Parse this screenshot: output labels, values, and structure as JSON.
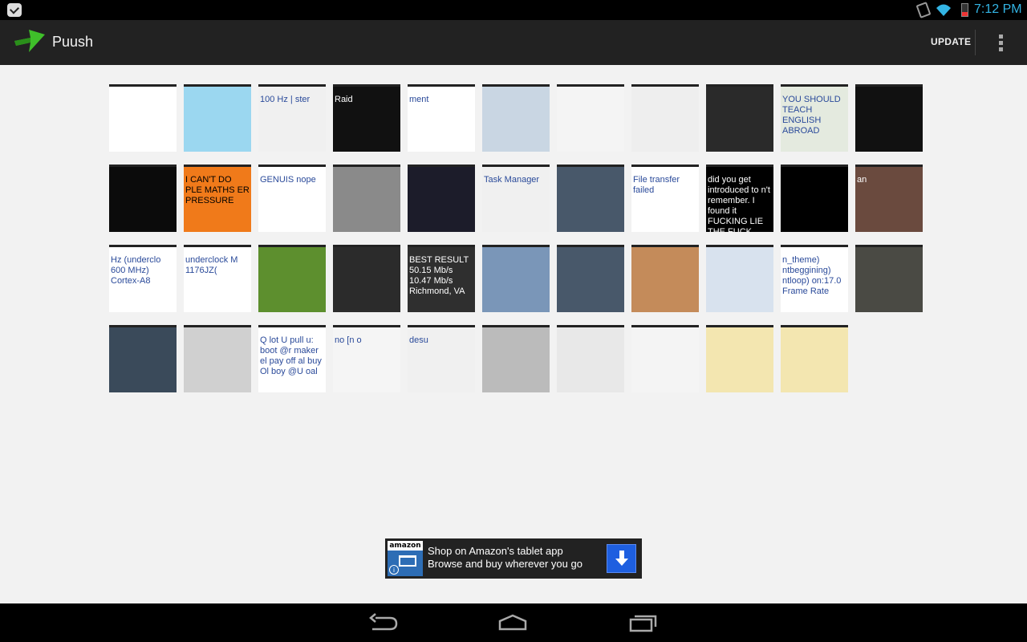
{
  "status_bar": {
    "time": "7:12 PM",
    "icons": [
      "notification-icon",
      "screen-rotation-icon",
      "wifi-icon",
      "battery-icon"
    ]
  },
  "action_bar": {
    "title": "Puush",
    "update_label": "UPDATE",
    "logo_icon": "puush-arrow-icon",
    "overflow_icon": "overflow-menu-icon",
    "accent_color": "#33b5e5",
    "logo_color": "#3fbf2a"
  },
  "thumbnails": [
    {
      "caption": "",
      "bg": "#ffffff"
    },
    {
      "caption": "",
      "bg": "#9bd7f0"
    },
    {
      "caption": "100 Hz | ster",
      "bg": "#f0f0f0"
    },
    {
      "caption": "Raid",
      "bg": "#111111"
    },
    {
      "caption": "ment",
      "bg": "#ffffff"
    },
    {
      "caption": "",
      "bg": "#c9d6e3"
    },
    {
      "caption": "",
      "bg": "#f4f4f4"
    },
    {
      "caption": "",
      "bg": "#eeeeee"
    },
    {
      "caption": "",
      "bg": "#2a2a2a"
    },
    {
      "caption": "YOU SHOULD TEACH ENGLISH ABROAD",
      "bg": "#e4eadf"
    },
    {
      "caption": "",
      "bg": "#111111"
    },
    {
      "caption": "",
      "bg": "#0b0b0b"
    },
    {
      "caption": "I CAN'T DO PLE MATHS ER PRESSURE",
      "bg": "#f07a1a"
    },
    {
      "caption": "GENUIS nope",
      "bg": "#ffffff"
    },
    {
      "caption": "",
      "bg": "#8a8a8a"
    },
    {
      "caption": "",
      "bg": "#1c1c2a"
    },
    {
      "caption": "Task Manager",
      "bg": "#f0f0f0"
    },
    {
      "caption": "",
      "bg": "#48586a"
    },
    {
      "caption": "File transfer failed",
      "bg": "#ffffff"
    },
    {
      "caption": "did you get introduced to n't remember. I found it FUCKING LIE THE FUCK OUT",
      "bg": "#000000"
    },
    {
      "caption": "",
      "bg": "#000000"
    },
    {
      "caption": "an",
      "bg": "#6a4a3e"
    },
    {
      "caption": "Hz (underclo 600 MHz) Cortex-A8",
      "bg": "#ffffff"
    },
    {
      "caption": "underclock M 1176JZ(",
      "bg": "#ffffff"
    },
    {
      "caption": "",
      "bg": "#5d8f2e"
    },
    {
      "caption": "",
      "bg": "#2b2b2b"
    },
    {
      "caption": "BEST RESULT 50.15 Mb/s 10.47 Mb/s Richmond, VA",
      "bg": "#2f2f2f"
    },
    {
      "caption": "",
      "bg": "#7a96b8"
    },
    {
      "caption": "",
      "bg": "#48586a"
    },
    {
      "caption": "",
      "bg": "#c48b5a"
    },
    {
      "caption": "",
      "bg": "#d8e2ee"
    },
    {
      "caption": "n_theme) ntbeggining) ntloop) on:17.0 Frame Rate",
      "bg": "#ffffff"
    },
    {
      "caption": "",
      "bg": "#4a4a44"
    },
    {
      "caption": "",
      "bg": "#3a4a5a"
    },
    {
      "caption": "",
      "bg": "#d0d0d0"
    },
    {
      "caption": "Q lot U pull u: boot @r maker el pay off al buy Ol boy @U oal",
      "bg": "#ffffff"
    },
    {
      "caption": "no [n o",
      "bg": "#f5f5f5"
    },
    {
      "caption": "desu",
      "bg": "#f0f0f0"
    },
    {
      "caption": "",
      "bg": "#bbbbbb"
    },
    {
      "caption": "",
      "bg": "#e8e8e8"
    },
    {
      "caption": "",
      "bg": "#f4f4f4"
    },
    {
      "caption": "",
      "bg": "#f3e6b0"
    },
    {
      "caption": "",
      "bg": "#f3e6b0"
    }
  ],
  "ad": {
    "brand": "amazon",
    "line1": "Shop on Amazon's tablet app",
    "line2": "Browse and buy wherever you go",
    "download_icon": "download-arrow-icon",
    "info_icon": "info-icon"
  },
  "nav_bar": {
    "buttons": [
      "back-icon",
      "home-icon",
      "recent-apps-icon"
    ]
  }
}
